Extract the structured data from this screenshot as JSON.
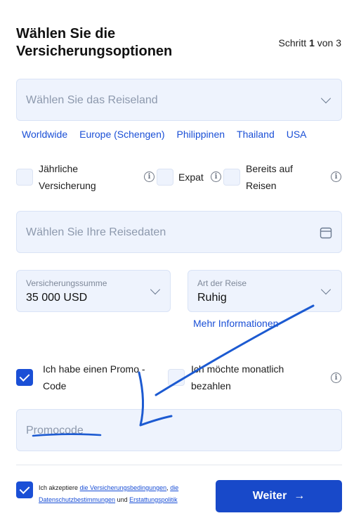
{
  "header": {
    "title_line1": "Wählen Sie die",
    "title_line2": "Versicherungsoptionen",
    "step_prefix": "Schritt",
    "step_current": "1",
    "step_suffix": "von 3"
  },
  "country": {
    "placeholder": "Wählen Sie das Reiseland",
    "quick_links": [
      "Worldwide",
      "Europe (Schengen)",
      "Philippinen",
      "Thailand",
      "USA"
    ]
  },
  "options": {
    "annual_line1": "Jährliche",
    "annual_line2": "Versicherung",
    "expat": "Expat",
    "traveling_line1": "Bereits auf",
    "traveling_line2": "Reisen"
  },
  "dates": {
    "placeholder": "Wählen Sie Ihre Reisedaten"
  },
  "coverage": {
    "label": "Versicherungssumme",
    "value": "35 000 USD"
  },
  "trip_type": {
    "label": "Art der Reise",
    "value": "Ruhig"
  },
  "more_info": "Mehr Informationen",
  "promo": {
    "checkbox_line1": "Ich habe einen Promo -",
    "checkbox_line2": "Code",
    "checked": true,
    "monthly_line1": "Ich möchte monatlich",
    "monthly_line2": "bezahlen",
    "input_placeholder": "Promocode"
  },
  "terms": {
    "prefix": "Ich akzeptiere",
    "link1": "die Versicherungsbedingungen",
    "sep": ",",
    "link2": "die Datenschutzbestimmungen",
    "and": "und",
    "link3": "Erstattungspolitik",
    "checked": true
  },
  "submit": {
    "label": "Weiter",
    "arrow": "→"
  },
  "colors": {
    "accent": "#1849c9",
    "link": "#1a4fd6",
    "field_bg": "#eef3fd",
    "annotation": "#1c5ad1"
  }
}
